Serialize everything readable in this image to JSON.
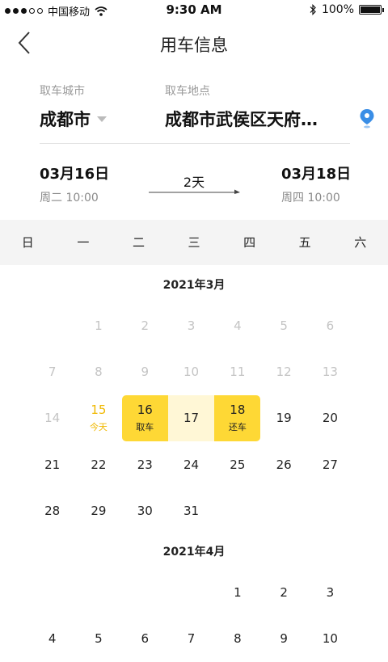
{
  "status_bar": {
    "carrier": "中国移动",
    "time": "9:30 AM",
    "battery": "100%"
  },
  "nav": {
    "title": "用车信息",
    "back_icon": "chevron-left-icon"
  },
  "pickup": {
    "city_label": "取车城市",
    "city": "成都市",
    "location_label": "取车地点",
    "location": "成都市武侯区天府…",
    "location_icon": "map-pin-icon"
  },
  "dates": {
    "start_date": "03月16日",
    "start_sub": "周二 10:00",
    "duration": "2天",
    "end_date": "03月18日",
    "end_sub": "周四 10:00"
  },
  "weekdays": [
    "日",
    "一",
    "二",
    "三",
    "四",
    "五",
    "六"
  ],
  "months": [
    {
      "title": "2021年3月",
      "offset": 1,
      "days": [
        "1",
        "2",
        "3",
        "4",
        "5",
        "6",
        "7",
        "8",
        "9",
        "10",
        "11",
        "12",
        "13",
        "14",
        "15",
        "16",
        "17",
        "18",
        "19",
        "20",
        "21",
        "22",
        "23",
        "24",
        "25",
        "26",
        "27",
        "28",
        "29",
        "30",
        "31"
      ],
      "past_until": 14,
      "today": 15,
      "today_label": "今天",
      "start": 16,
      "start_label": "取车",
      "end": 18,
      "end_label": "还车"
    },
    {
      "title": "2021年4月",
      "offset": 4,
      "days": [
        "1",
        "2",
        "3",
        "4",
        "5",
        "6",
        "7",
        "8",
        "9",
        "10"
      ]
    }
  ],
  "colors": {
    "accent": "#fed835",
    "today": "#f0b800",
    "pin": "#3a8ee6"
  }
}
